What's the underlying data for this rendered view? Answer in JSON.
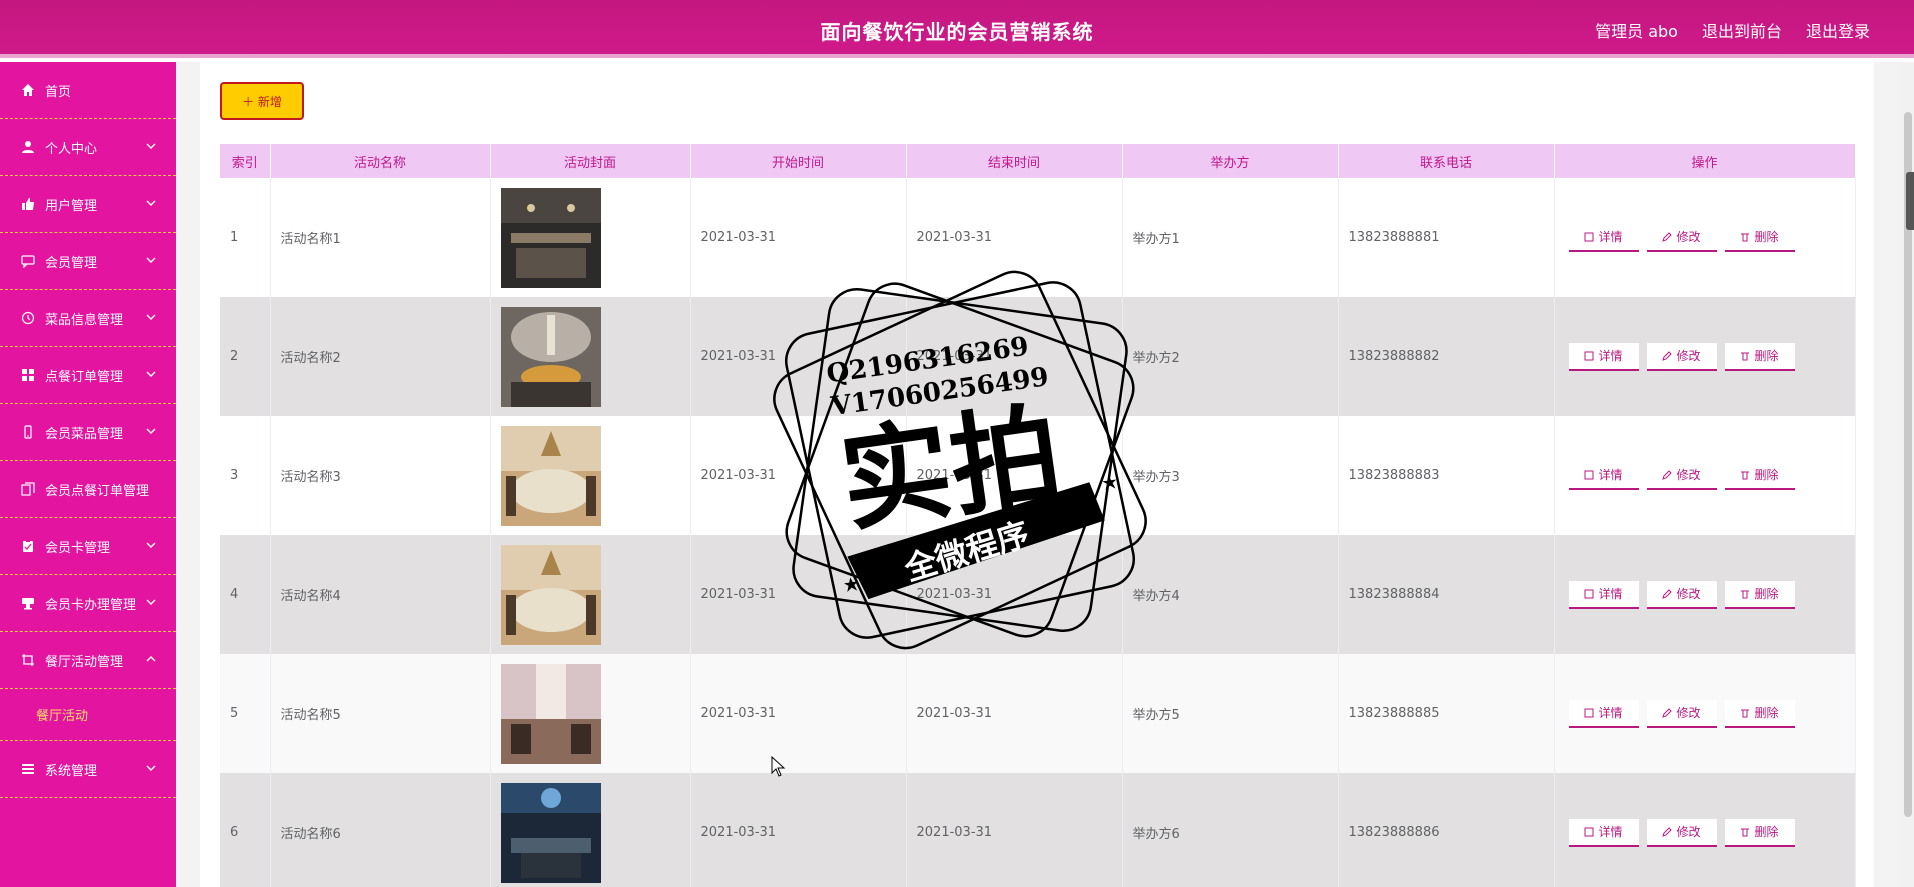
{
  "header": {
    "title": "面向餐饮行业的会员营销系统",
    "links": [
      "管理员 abo",
      "退出到前台",
      "退出登录"
    ]
  },
  "sidebar": {
    "items": [
      {
        "label": "首页",
        "icon": "home-icon",
        "expandable": false
      },
      {
        "label": "个人中心",
        "icon": "user-icon",
        "expandable": true
      },
      {
        "label": "用户管理",
        "icon": "thumb-icon",
        "expandable": true
      },
      {
        "label": "会员管理",
        "icon": "chat-icon",
        "expandable": true
      },
      {
        "label": "菜品信息管理",
        "icon": "clock-icon",
        "expandable": true
      },
      {
        "label": "点餐订单管理",
        "icon": "grid-icon",
        "expandable": true
      },
      {
        "label": "会员菜品管理",
        "icon": "phone-icon",
        "expandable": true
      },
      {
        "label": "会员点餐订单管理",
        "icon": "copy-icon",
        "expandable": false
      },
      {
        "label": "会员卡管理",
        "icon": "clipboard-icon",
        "expandable": true
      },
      {
        "label": "会员卡办理管理",
        "icon": "cup-icon",
        "expandable": true
      },
      {
        "label": "餐厅活动管理",
        "icon": "crop-icon",
        "expandable": true,
        "open": true
      },
      {
        "label": "餐厅活动",
        "sub": true
      },
      {
        "label": "系统管理",
        "icon": "list-icon",
        "expandable": true
      }
    ]
  },
  "toolbar": {
    "add_label": "＋ 新增"
  },
  "table": {
    "columns": [
      "索引",
      "活动名称",
      "活动封面",
      "开始时间",
      "结束时间",
      "举办方",
      "联系电话",
      "操作"
    ],
    "actions": [
      "详情",
      "修改",
      "删除"
    ],
    "rows": [
      {
        "index": "1",
        "name": "活动名称1",
        "start": "2021-03-31",
        "end": "2021-03-31",
        "host": "举办方1",
        "phone": "13823888881"
      },
      {
        "index": "2",
        "name": "活动名称2",
        "start": "2021-03-31",
        "end": "2021-03-31",
        "host": "举办方2",
        "phone": "13823888882"
      },
      {
        "index": "3",
        "name": "活动名称3",
        "start": "2021-03-31",
        "end": "2021-03-31",
        "host": "举办方3",
        "phone": "13823888883"
      },
      {
        "index": "4",
        "name": "活动名称4",
        "start": "2021-03-31",
        "end": "2021-03-31",
        "host": "举办方4",
        "phone": "13823888884"
      },
      {
        "index": "5",
        "name": "活动名称5",
        "start": "2021-03-31",
        "end": "2021-03-31",
        "host": "举办方5",
        "phone": "13823888885"
      },
      {
        "index": "6",
        "name": "活动名称6",
        "start": "2021-03-31",
        "end": "2021-03-31",
        "host": "举办方6",
        "phone": "13823888886"
      }
    ]
  },
  "watermark": {
    "qq": "Q2196316269",
    "vx": "V17060256499",
    "big": "实拍",
    "banner": "全微程序"
  },
  "colors": {
    "accent": "#e315a0",
    "header": "#c4177f",
    "table_head": "#f0c8f4",
    "add_button": "#ffcc00"
  }
}
